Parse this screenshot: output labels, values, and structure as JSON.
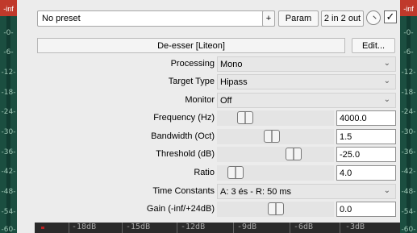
{
  "meters": {
    "left_peak": "-inf",
    "right_peak": "-inf",
    "ticks": [
      "-0-",
      "-6-",
      "-12-",
      "-18-",
      "-24-",
      "-30-",
      "-36-",
      "-42-",
      "-48-",
      "-54-",
      "-60-"
    ]
  },
  "toolbar": {
    "preset_value": "No preset",
    "add_label": "+",
    "param_label": "Param",
    "io_label": "2 in 2 out",
    "enabled_check": "✓"
  },
  "plugin": {
    "title": "De-esser [Liteon]",
    "edit_label": "Edit..."
  },
  "params": {
    "processing": {
      "label": "Processing",
      "value": "Mono"
    },
    "target_type": {
      "label": "Target Type",
      "value": "Hipass"
    },
    "monitor": {
      "label": "Monitor",
      "value": "Off"
    },
    "frequency": {
      "label": "Frequency (Hz)",
      "value": "4000.0",
      "slider": 0.2
    },
    "bandwidth": {
      "label": "Bandwidth (Oct)",
      "value": "1.5",
      "slider": 0.46
    },
    "threshold": {
      "label": "Threshold (dB)",
      "value": "-25.0",
      "slider": 0.68
    },
    "ratio": {
      "label": "Ratio",
      "value": "4.0",
      "slider": 0.1
    },
    "time_constants": {
      "label": "Time Constants",
      "value": "A: 3 és - R: 50 ms"
    },
    "gain": {
      "label": "Gain (-inf/+24dB)",
      "value": "0.0",
      "slider": 0.5
    }
  },
  "bottom_meter": {
    "ticks": [
      "-18dB",
      "-15dB",
      "-12dB",
      "-9dB",
      "-6dB",
      "-3dB"
    ]
  }
}
